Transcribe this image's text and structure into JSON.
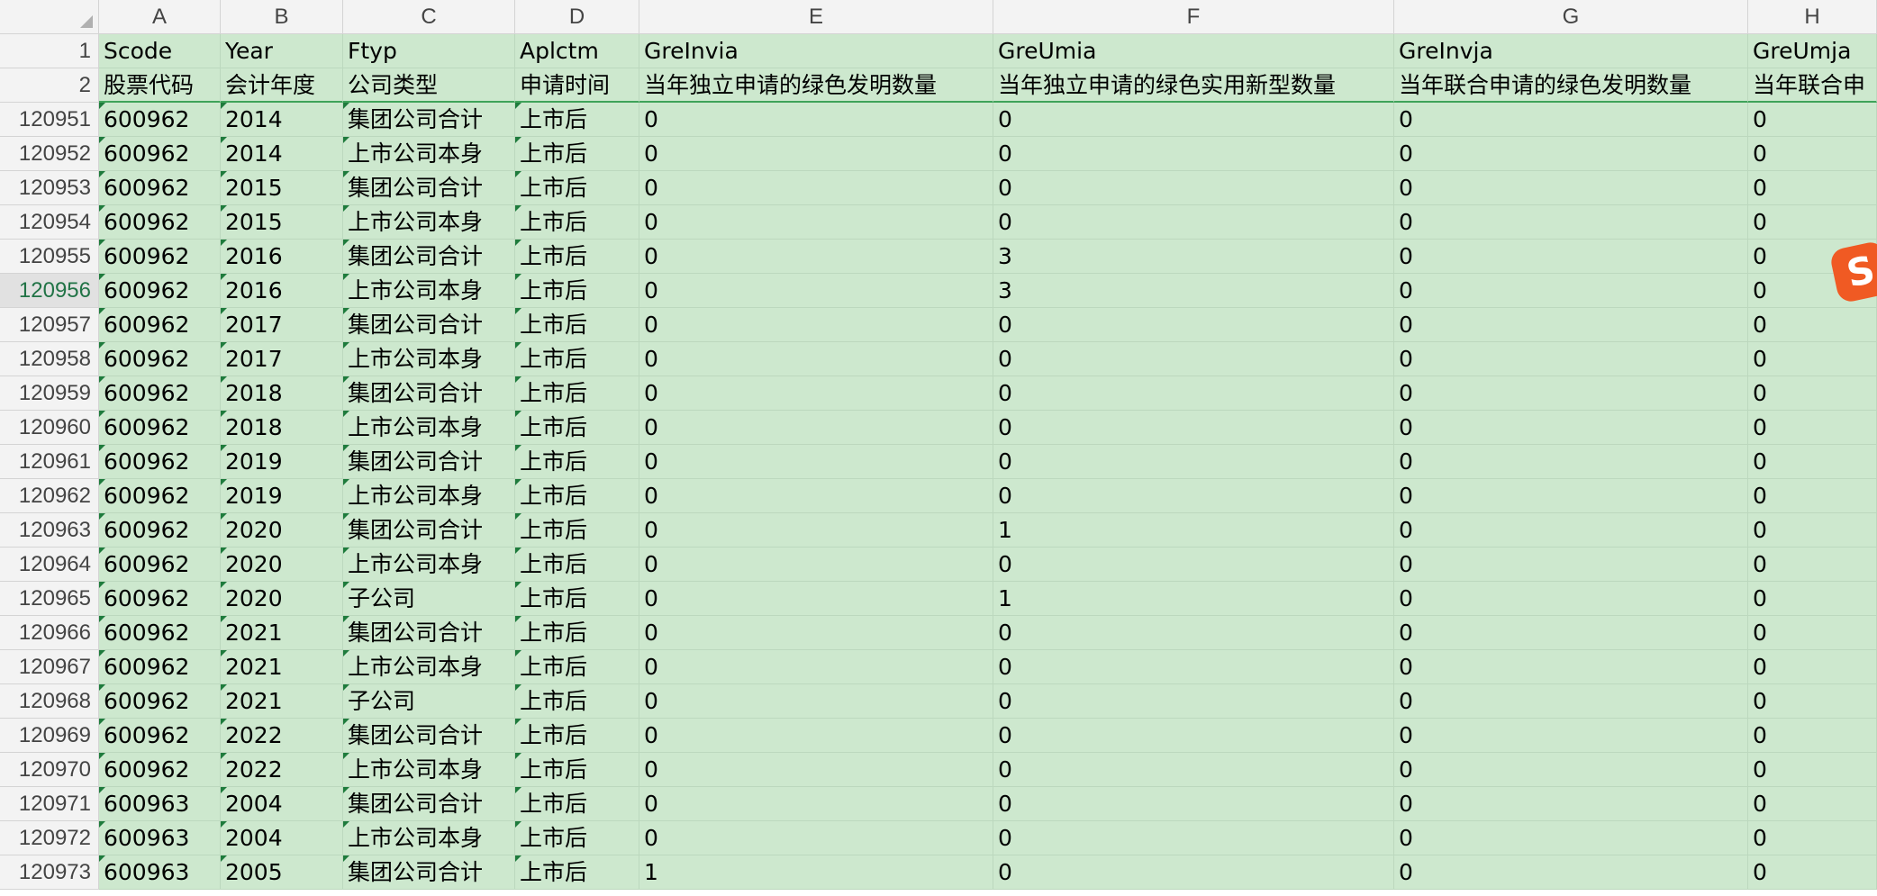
{
  "columns": [
    "A",
    "B",
    "C",
    "D",
    "E",
    "F",
    "G",
    "H"
  ],
  "header_rows": [
    {
      "row_num": "1",
      "cells": [
        "Scode",
        "Year",
        "Ftyp",
        "Aplctm",
        "GreInvia",
        "GreUmia",
        "GreInvja",
        "GreUmja"
      ]
    },
    {
      "row_num": "2",
      "cells": [
        "股票代码",
        "会计年度",
        "公司类型",
        "申请时间",
        "当年独立申请的绿色发明数量",
        "当年独立申请的绿色实用新型数量",
        "当年联合申请的绿色发明数量",
        "当年联合申"
      ]
    }
  ],
  "rows": [
    {
      "row_num": "120951",
      "cells": [
        "600962",
        "2014",
        "集团公司合计",
        "上市后",
        "0",
        "0",
        "0",
        "0"
      ]
    },
    {
      "row_num": "120952",
      "cells": [
        "600962",
        "2014",
        "上市公司本身",
        "上市后",
        "0",
        "0",
        "0",
        "0"
      ]
    },
    {
      "row_num": "120953",
      "cells": [
        "600962",
        "2015",
        "集团公司合计",
        "上市后",
        "0",
        "0",
        "0",
        "0"
      ]
    },
    {
      "row_num": "120954",
      "cells": [
        "600962",
        "2015",
        "上市公司本身",
        "上市后",
        "0",
        "0",
        "0",
        "0"
      ]
    },
    {
      "row_num": "120955",
      "cells": [
        "600962",
        "2016",
        "集团公司合计",
        "上市后",
        "0",
        "3",
        "0",
        "0"
      ]
    },
    {
      "row_num": "120956",
      "cells": [
        "600962",
        "2016",
        "上市公司本身",
        "上市后",
        "0",
        "3",
        "0",
        "0"
      ]
    },
    {
      "row_num": "120957",
      "cells": [
        "600962",
        "2017",
        "集团公司合计",
        "上市后",
        "0",
        "0",
        "0",
        "0"
      ]
    },
    {
      "row_num": "120958",
      "cells": [
        "600962",
        "2017",
        "上市公司本身",
        "上市后",
        "0",
        "0",
        "0",
        "0"
      ]
    },
    {
      "row_num": "120959",
      "cells": [
        "600962",
        "2018",
        "集团公司合计",
        "上市后",
        "0",
        "0",
        "0",
        "0"
      ]
    },
    {
      "row_num": "120960",
      "cells": [
        "600962",
        "2018",
        "上市公司本身",
        "上市后",
        "0",
        "0",
        "0",
        "0"
      ]
    },
    {
      "row_num": "120961",
      "cells": [
        "600962",
        "2019",
        "集团公司合计",
        "上市后",
        "0",
        "0",
        "0",
        "0"
      ]
    },
    {
      "row_num": "120962",
      "cells": [
        "600962",
        "2019",
        "上市公司本身",
        "上市后",
        "0",
        "0",
        "0",
        "0"
      ]
    },
    {
      "row_num": "120963",
      "cells": [
        "600962",
        "2020",
        "集团公司合计",
        "上市后",
        "0",
        "1",
        "0",
        "0"
      ]
    },
    {
      "row_num": "120964",
      "cells": [
        "600962",
        "2020",
        "上市公司本身",
        "上市后",
        "0",
        "0",
        "0",
        "0"
      ]
    },
    {
      "row_num": "120965",
      "cells": [
        "600962",
        "2020",
        "子公司",
        "上市后",
        "0",
        "1",
        "0",
        "0"
      ]
    },
    {
      "row_num": "120966",
      "cells": [
        "600962",
        "2021",
        "集团公司合计",
        "上市后",
        "0",
        "0",
        "0",
        "0"
      ]
    },
    {
      "row_num": "120967",
      "cells": [
        "600962",
        "2021",
        "上市公司本身",
        "上市后",
        "0",
        "0",
        "0",
        "0"
      ]
    },
    {
      "row_num": "120968",
      "cells": [
        "600962",
        "2021",
        "子公司",
        "上市后",
        "0",
        "0",
        "0",
        "0"
      ]
    },
    {
      "row_num": "120969",
      "cells": [
        "600962",
        "2022",
        "集团公司合计",
        "上市后",
        "0",
        "0",
        "0",
        "0"
      ]
    },
    {
      "row_num": "120970",
      "cells": [
        "600962",
        "2022",
        "上市公司本身",
        "上市后",
        "0",
        "0",
        "0",
        "0"
      ]
    },
    {
      "row_num": "120971",
      "cells": [
        "600963",
        "2004",
        "集团公司合计",
        "上市后",
        "0",
        "0",
        "0",
        "0"
      ]
    },
    {
      "row_num": "120972",
      "cells": [
        "600963",
        "2004",
        "上市公司本身",
        "上市后",
        "0",
        "0",
        "0",
        "0"
      ]
    },
    {
      "row_num": "120973",
      "cells": [
        "600963",
        "2005",
        "集团公司合计",
        "上市后",
        "1",
        "0",
        "0",
        "0"
      ]
    }
  ],
  "active_row": "120956",
  "logo_text": "S",
  "colors": {
    "data_fill": "#cde8ce",
    "header_fill": "#f3f3f3",
    "active_row_num": "#217346",
    "logo": "#f05a23"
  }
}
